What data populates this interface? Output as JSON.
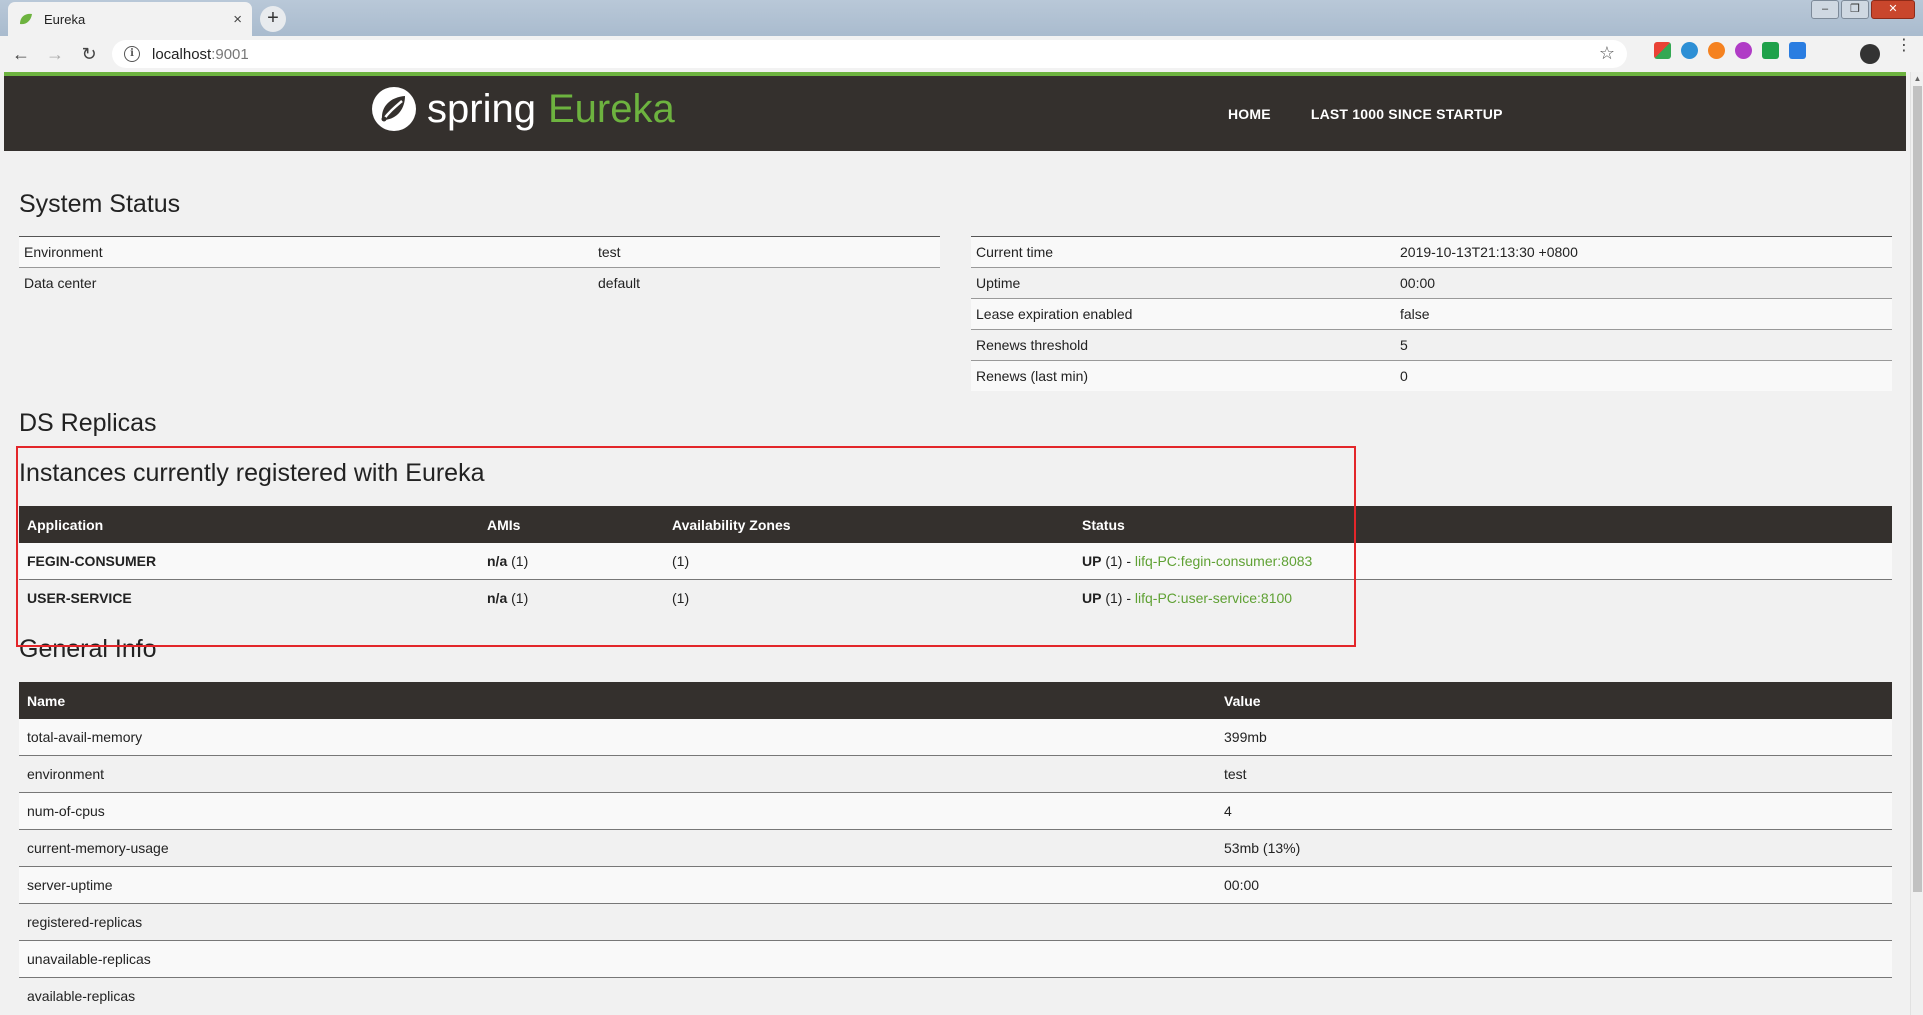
{
  "browser": {
    "tab_title": "Eureka",
    "tab_close": "×",
    "new_tab": "+",
    "url_host": "localhost",
    "url_port": ":9001",
    "window_controls": [
      "–",
      "❐",
      "✕"
    ]
  },
  "header": {
    "logo_spring": "spring",
    "logo_eureka": "Eureka",
    "nav": [
      "HOME",
      "LAST 1000 SINCE STARTUP"
    ]
  },
  "system_status": {
    "title": "System Status",
    "left": [
      {
        "key": "Environment",
        "value": "test"
      },
      {
        "key": "Data center",
        "value": "default"
      }
    ],
    "right": [
      {
        "key": "Current time",
        "value": "2019-10-13T21:13:30 +0800"
      },
      {
        "key": "Uptime",
        "value": "00:00"
      },
      {
        "key": "Lease expiration enabled",
        "value": "false"
      },
      {
        "key": "Renews threshold",
        "value": "5"
      },
      {
        "key": "Renews (last min)",
        "value": "0"
      }
    ]
  },
  "ds_replicas": {
    "title": "DS Replicas"
  },
  "instances": {
    "title": "Instances currently registered with Eureka",
    "columns": [
      "Application",
      "AMIs",
      "Availability Zones",
      "Status"
    ],
    "rows": [
      {
        "application": "FEGIN-CONSUMER",
        "ami_label": "n/a",
        "ami_count": "(1)",
        "zones": "(1)",
        "status": "UP",
        "status_count": "(1) -",
        "instance": "lifq-PC:fegin-consumer:8083"
      },
      {
        "application": "USER-SERVICE",
        "ami_label": "n/a",
        "ami_count": "(1)",
        "zones": "(1)",
        "status": "UP",
        "status_count": "(1) -",
        "instance": "lifq-PC:user-service:8100"
      }
    ]
  },
  "general_info": {
    "title": "General Info",
    "columns": [
      "Name",
      "Value"
    ],
    "rows": [
      {
        "name": "total-avail-memory",
        "value": "399mb"
      },
      {
        "name": "environment",
        "value": "test"
      },
      {
        "name": "num-of-cpus",
        "value": "4"
      },
      {
        "name": "current-memory-usage",
        "value": "53mb (13%)"
      },
      {
        "name": "server-uptime",
        "value": "00:00"
      },
      {
        "name": "registered-replicas",
        "value": ""
      },
      {
        "name": "unavailable-replicas",
        "value": ""
      },
      {
        "name": "available-replicas",
        "value": ""
      }
    ]
  },
  "colors": {
    "brand_green": "#6db33f",
    "navbar_bg": "#34302d",
    "highlight_box": "#e3262a"
  }
}
